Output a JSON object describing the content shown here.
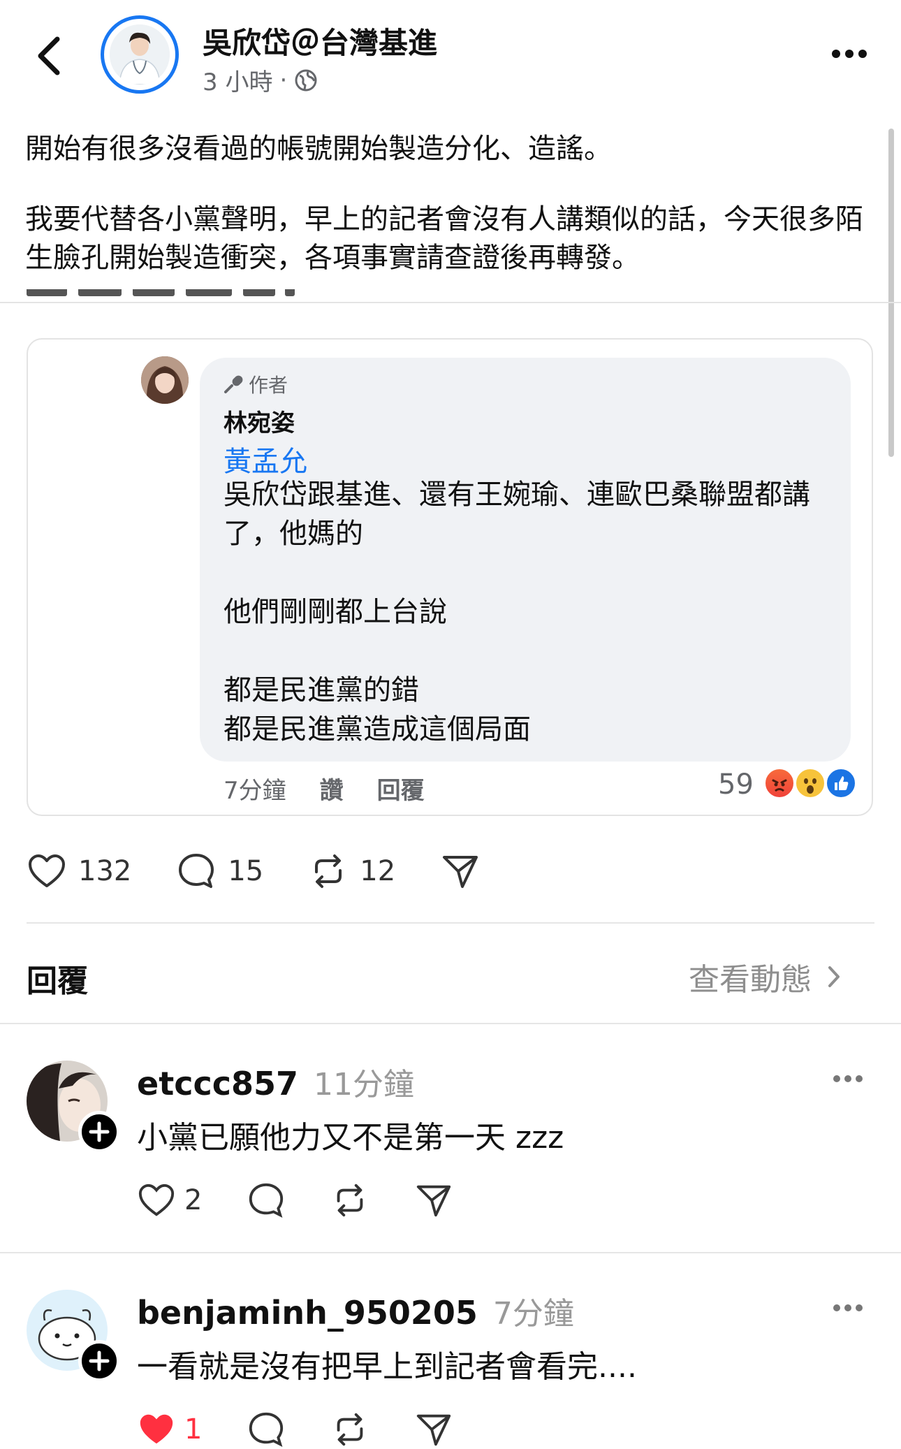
{
  "header": {
    "author": "吳欣岱＠台灣基進",
    "time": "3 小時",
    "separator": "·",
    "icons": {
      "back": "chevron-left-icon",
      "privacy": "globe-icon",
      "more": "more-horizontal-icon"
    },
    "accent": "#1877f2"
  },
  "post": {
    "paragraph1": "開始有很多沒看過的帳號開始製造分化、造謠。",
    "paragraph2": "我要代替各小黨聲明，早上的記者會沒有人講類似的話，今天很多陌生臉孔開始製造衝突，各項事實請查證後再轉發。"
  },
  "embedded_comment": {
    "author_tag": "作者",
    "name": "林宛姿",
    "mention": "黃孟允",
    "body": [
      "吳欣岱跟基進、還有王婉瑜、連歐巴桑聯盟都講了，他媽的",
      "他們剛剛都上台說",
      "都是民進黨的錯\n都是民進黨造成這個局面"
    ],
    "time": "7分鐘",
    "like_label": "讚",
    "reply_label": "回覆",
    "reaction_count": "59",
    "reactions": [
      "angry",
      "wow",
      "like"
    ]
  },
  "engagement": {
    "likes": "132",
    "comments": "15",
    "reposts": "12",
    "icons": [
      "heart-icon",
      "comment-icon",
      "repost-icon",
      "share-icon"
    ]
  },
  "replies": {
    "title": "回覆",
    "view_activity": "查看動態",
    "items": [
      {
        "username": "etccc857",
        "time": "11分鐘",
        "text": "小黨已願他力又不是第一天 zzz",
        "likes": "2"
      },
      {
        "username": "benjaminh_950205",
        "time": "7分鐘",
        "text": "一看就是沒有把早上到記者會看完....",
        "likes": "1"
      }
    ]
  }
}
